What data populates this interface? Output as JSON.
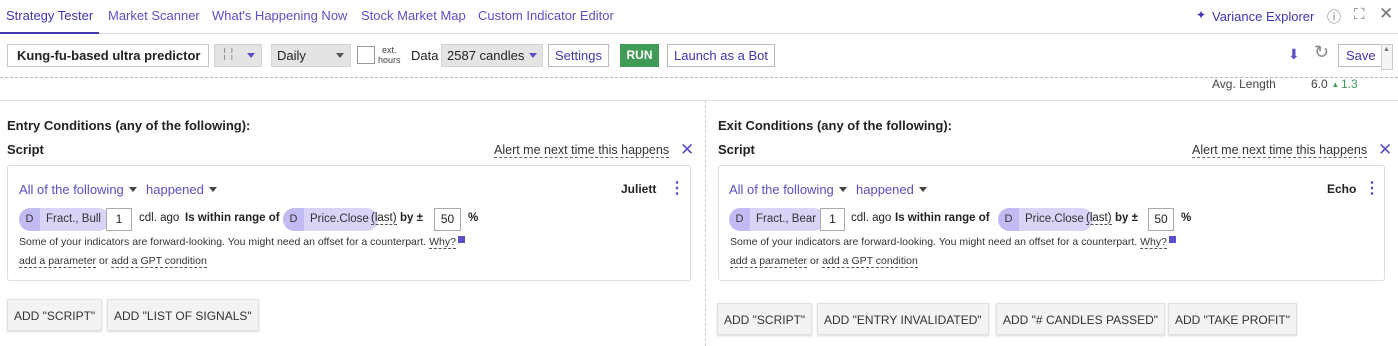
{
  "nav": {
    "tabs": [
      {
        "label": "Strategy Tester"
      },
      {
        "label": "Market Scanner"
      },
      {
        "label": "What's Happening Now"
      },
      {
        "label": "Stock Market Map"
      },
      {
        "label": "Custom Indicator Editor"
      }
    ],
    "variance_label": "Variance Explorer"
  },
  "toolbar": {
    "strategy_name": "Kung-fu-based ultra predictor",
    "timeframe": "Daily",
    "ext_hours_line1": "ext.",
    "ext_hours_line2": "hours",
    "data_label": "Data",
    "data_value": "2587 candles",
    "settings_label": "Settings",
    "run_label": "RUN",
    "bot_label": "Launch as a Bot",
    "save_label": "Save"
  },
  "stats": {
    "avg_length_label": "Avg. Length",
    "avg_length_value": "6.0",
    "avg_length_delta": "1.3"
  },
  "entry": {
    "title": "Entry Conditions (any of the following):",
    "script_label": "Script",
    "alert_label": "Alert me next time this happens",
    "mode": "All of the following",
    "when": "happened",
    "name": "Juliett",
    "pill1_d": "D",
    "pill1": "Fract., Bull",
    "offset": "1",
    "cdl_ago": "cdl. ago",
    "range_text": "Is within range of",
    "pill2_d": "D",
    "pill2": "Price.Close",
    "last": "(last)",
    "by_pm": "by ±",
    "pct_value": "50",
    "pct_sign": "%",
    "note": "Some of your indicators are forward-looking. You might need an offset for a counterpart.",
    "why": "Why?",
    "add_param": "add a parameter",
    "or": "or",
    "add_gpt": "add a GPT condition",
    "buttons": [
      "ADD \"SCRIPT\"",
      "ADD \"LIST OF SIGNALS\""
    ]
  },
  "exit": {
    "title": "Exit Conditions (any of the following):",
    "script_label": "Script",
    "alert_label": "Alert me next time this happens",
    "mode": "All of the following",
    "when": "happened",
    "name": "Echo",
    "pill1_d": "D",
    "pill1": "Fract., Bear",
    "offset": "1",
    "cdl_ago": "cdl. ago",
    "range_text": "Is within range of",
    "pill2_d": "D",
    "pill2": "Price.Close",
    "last": "(last)",
    "by_pm": "by ±",
    "pct_value": "50",
    "pct_sign": "%",
    "note": "Some of your indicators are forward-looking. You might need an offset for a counterpart.",
    "why": "Why?",
    "add_param": "add a parameter",
    "or": "or",
    "add_gpt": "add a GPT condition",
    "buttons": [
      "ADD \"SCRIPT\"",
      "ADD \"ENTRY INVALIDATED\"",
      "ADD \"# CANDLES PASSED\"",
      "ADD \"TAKE PROFIT\""
    ]
  },
  "colors": {
    "accent": "#5b4fc7",
    "run": "#3f9b55",
    "pill": "#d8d3f7"
  }
}
